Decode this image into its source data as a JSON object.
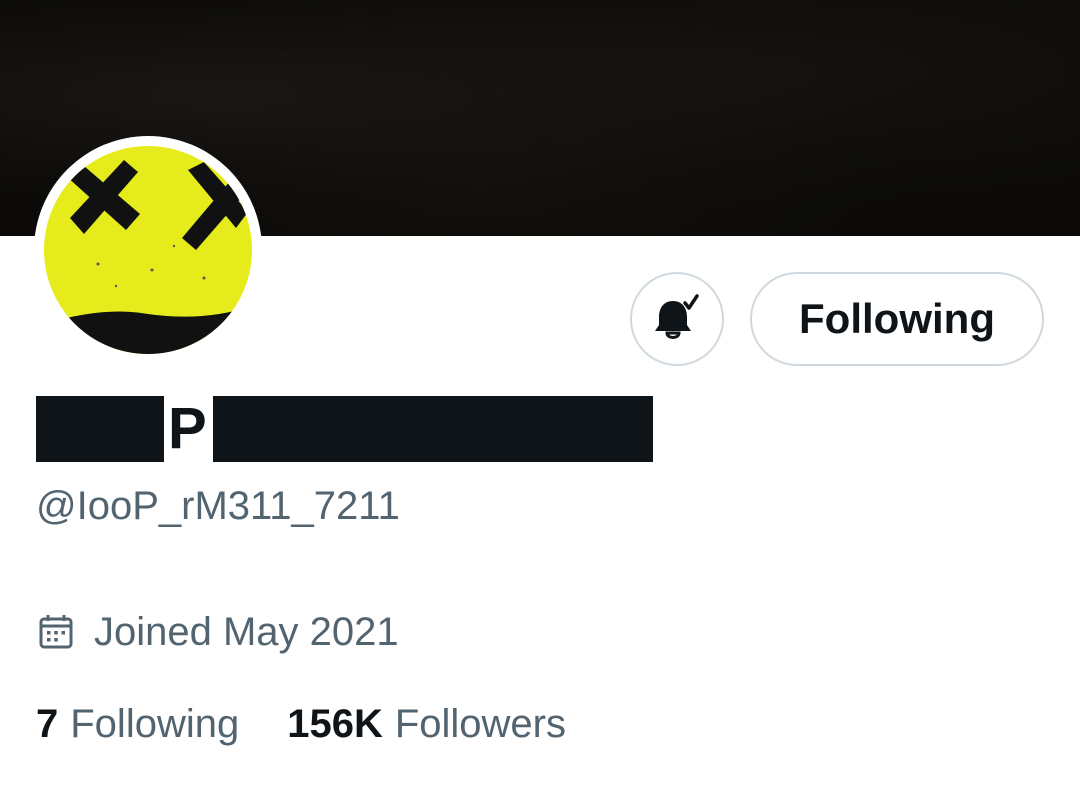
{
  "profile": {
    "display_name_visible_letter": "P",
    "handle": "@IooP_rM311_7211",
    "joined": "Joined May 2021"
  },
  "actions": {
    "notification_icon": "bell-check-icon",
    "following_label": "Following"
  },
  "stats": {
    "following_count": "7",
    "following_label": "Following",
    "followers_count": "156K",
    "followers_label": "Followers"
  },
  "colors": {
    "banner": "#0b0a08",
    "avatar_yellow": "#e6ec1c",
    "text_primary": "#0f1419",
    "text_secondary": "#536471",
    "button_border": "#cfd9de"
  }
}
